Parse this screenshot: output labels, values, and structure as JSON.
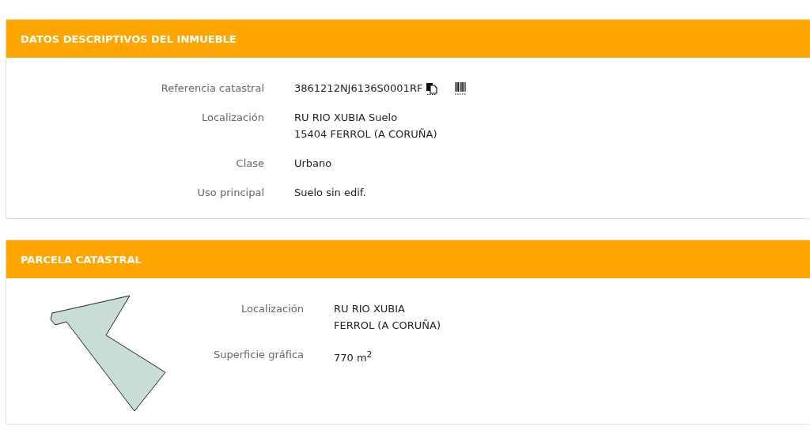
{
  "sections": [
    {
      "title": "DATOS DESCRIPTIVOS DEL INMUEBLE",
      "kind": "details",
      "rows": [
        {
          "label": "Referencia catastral",
          "lines": [
            "3861212NJ6136S0001RF"
          ],
          "kind": "reference"
        },
        {
          "label": "Localización",
          "lines": [
            "RU RIO XUBIA Suelo",
            "15404 FERROL (A CORUÑA)"
          ],
          "kind": "text"
        },
        {
          "label": "Clase",
          "lines": [
            "Urbano"
          ],
          "kind": "text"
        },
        {
          "label": "Uso principal",
          "lines": [
            "Suelo sin edif."
          ],
          "kind": "text"
        }
      ]
    },
    {
      "title": "PARCELA CATASTRAL",
      "kind": "parcel",
      "rows": [
        {
          "label": "Localización",
          "lines": [
            "RU RIO XUBIA",
            "FERROL (A CORUÑA)"
          ],
          "kind": "text"
        },
        {
          "label": "Superficie gráfica",
          "lines": [
            "770 m$^{2}$"
          ],
          "kind": "text"
        }
      ]
    }
  ]
}
